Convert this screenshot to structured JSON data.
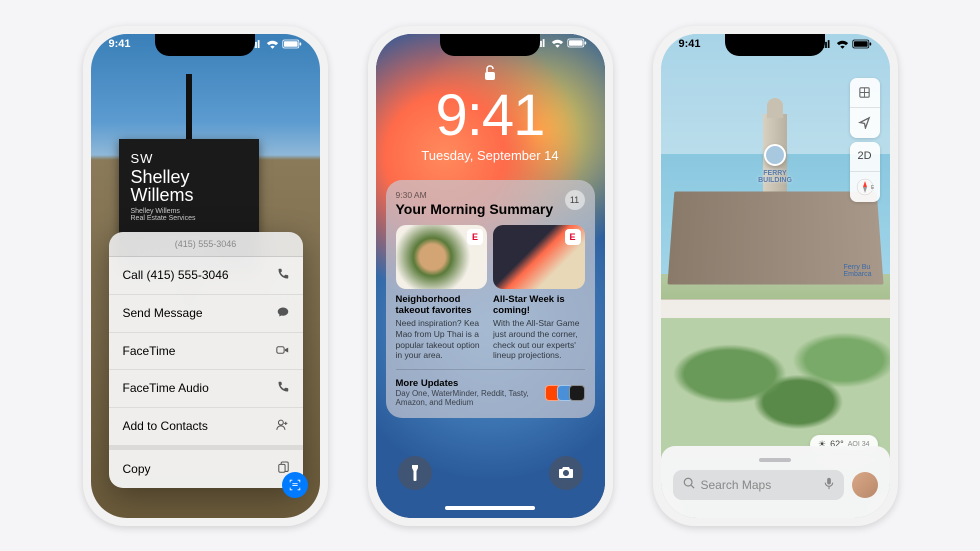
{
  "status": {
    "time": "9:41"
  },
  "phone1": {
    "sign": {
      "sw": "SW",
      "name": "Shelley\nWillems",
      "service": "Shelley Willems\nReal Estate Services",
      "phone": "(415) 555-3046"
    },
    "ctx": {
      "header": "(415) 555-3046",
      "items": [
        {
          "label": "Call (415) 555-3046",
          "icon": "phone"
        },
        {
          "label": "Send Message",
          "icon": "message"
        },
        {
          "label": "FaceTime",
          "icon": "video"
        },
        {
          "label": "FaceTime Audio",
          "icon": "phone"
        },
        {
          "label": "Add to Contacts",
          "icon": "person-add"
        },
        {
          "label": "Copy",
          "icon": "copy"
        }
      ]
    }
  },
  "phone2": {
    "time": "9:41",
    "date": "Tuesday, September 14",
    "summary": {
      "time": "9:30 AM",
      "title": "Your Morning Summary",
      "count": "11",
      "cards": [
        {
          "title": "Neighborhood takeout favorites",
          "body": "Need inspiration? Kea Mao from Up Thai is a popular takeout option in your area.",
          "app": "E",
          "app_color": "#e4002b"
        },
        {
          "title": "All-Star Week is coming!",
          "body": "With the All-Star Game just around the corner, check out our experts' lineup projections.",
          "app": "E",
          "app_color": "#e4002b"
        }
      ],
      "more": {
        "title": "More Updates",
        "body": "Day One, WaterMinder, Reddit, Tasty, Amazon, and Medium",
        "icon_colors": [
          "#ff4500",
          "#4a90d9",
          "#1a1a1a"
        ]
      }
    }
  },
  "phone3": {
    "landmark": "FERRY\nBUILDING",
    "embarcadero": "Ferry Bu\nEmbarca",
    "controls": {
      "info": "i",
      "location": "➤",
      "view2d": "2D",
      "compass": "E"
    },
    "weather": {
      "temp": "62°",
      "aqi": "AQI 34"
    },
    "search": {
      "placeholder": "Search Maps"
    }
  }
}
